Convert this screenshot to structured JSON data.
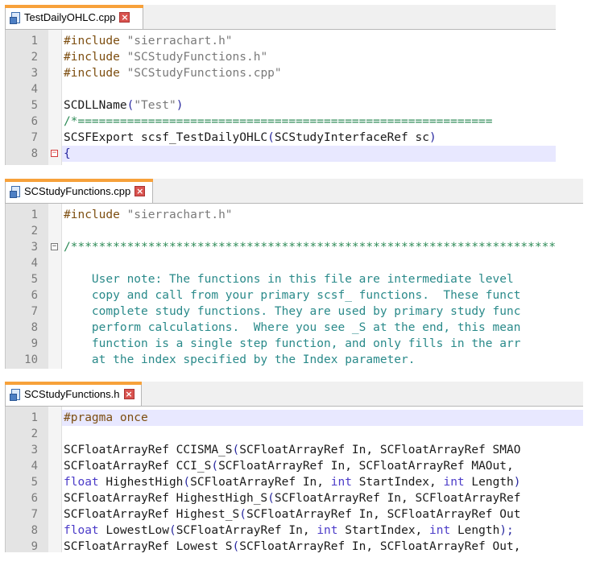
{
  "panels": [
    {
      "tab": "TestDailyOHLC.cpp",
      "lines": [
        {
          "n": "1",
          "segs": [
            [
              "pre",
              "#include "
            ],
            [
              "str",
              "\"sierrachart.h\""
            ]
          ]
        },
        {
          "n": "2",
          "segs": [
            [
              "pre",
              "#include "
            ],
            [
              "str",
              "\"SCStudyFunctions.h\""
            ]
          ]
        },
        {
          "n": "3",
          "segs": [
            [
              "pre",
              "#include "
            ],
            [
              "str",
              "\"SCStudyFunctions.cpp\""
            ]
          ]
        },
        {
          "n": "4",
          "segs": []
        },
        {
          "n": "5",
          "segs": [
            [
              "txt",
              "SCDLLName"
            ],
            [
              "punc",
              "("
            ],
            [
              "str",
              "\"Test\""
            ],
            [
              "punc",
              ")"
            ]
          ]
        },
        {
          "n": "6",
          "segs": [
            [
              "com",
              "/*==========================================================="
            ]
          ]
        },
        {
          "n": "7",
          "segs": [
            [
              "txt",
              "SCSFExport scsf_TestDailyOHLC"
            ],
            [
              "punc",
              "("
            ],
            [
              "txt",
              "SCStudyInterfaceRef sc"
            ],
            [
              "punc",
              ")"
            ]
          ]
        },
        {
          "n": "8",
          "segs": [
            [
              "punc",
              "{"
            ]
          ]
        }
      ]
    },
    {
      "tab": "SCStudyFunctions.cpp",
      "lines": [
        {
          "n": "1",
          "segs": [
            [
              "pre",
              "#include "
            ],
            [
              "str",
              "\"sierrachart.h\""
            ]
          ]
        },
        {
          "n": "2",
          "segs": []
        },
        {
          "n": "3",
          "segs": [
            [
              "com",
              "/*********************************************************************"
            ]
          ]
        },
        {
          "n": "4",
          "segs": []
        },
        {
          "n": "5",
          "segs": [
            [
              "note",
              "    User note: The functions in this file are intermediate level"
            ]
          ]
        },
        {
          "n": "6",
          "segs": [
            [
              "note",
              "    copy and call from your primary scsf_ functions.  These funct"
            ]
          ]
        },
        {
          "n": "7",
          "segs": [
            [
              "note",
              "    complete study functions. They are used by primary study func"
            ]
          ]
        },
        {
          "n": "8",
          "segs": [
            [
              "note",
              "    perform calculations.  Where you see _S at the end, this mean"
            ]
          ]
        },
        {
          "n": "9",
          "segs": [
            [
              "note",
              "    function is a single step function, and only fills in the arr"
            ]
          ]
        },
        {
          "n": "10",
          "segs": [
            [
              "note",
              "    at the index specified by the Index parameter."
            ]
          ]
        }
      ]
    },
    {
      "tab": "SCStudyFunctions.h",
      "lines": [
        {
          "n": "1",
          "segs": [
            [
              "pre",
              "#pragma once"
            ]
          ]
        },
        {
          "n": "2",
          "segs": []
        },
        {
          "n": "3",
          "segs": [
            [
              "txt",
              "SCFloatArrayRef CCISMA_S"
            ],
            [
              "punc",
              "("
            ],
            [
              "txt",
              "SCFloatArrayRef In, SCFloatArrayRef SMAO"
            ]
          ]
        },
        {
          "n": "4",
          "segs": [
            [
              "txt",
              "SCFloatArrayRef CCI_S"
            ],
            [
              "punc",
              "("
            ],
            [
              "txt",
              "SCFloatArrayRef In, SCFloatArrayRef MAOut,"
            ]
          ]
        },
        {
          "n": "5",
          "segs": [
            [
              "kw",
              "float"
            ],
            [
              "txt",
              " HighestHigh"
            ],
            [
              "punc",
              "("
            ],
            [
              "txt",
              "SCFloatArrayRef In, "
            ],
            [
              "kw",
              "int"
            ],
            [
              "txt",
              " StartIndex, "
            ],
            [
              "kw",
              "int"
            ],
            [
              "txt",
              " Length"
            ],
            [
              "punc",
              ")"
            ]
          ]
        },
        {
          "n": "6",
          "segs": [
            [
              "txt",
              "SCFloatArrayRef HighestHigh_S"
            ],
            [
              "punc",
              "("
            ],
            [
              "txt",
              "SCFloatArrayRef In, SCFloatArrayRef"
            ]
          ]
        },
        {
          "n": "7",
          "segs": [
            [
              "txt",
              "SCFloatArrayRef Highest_S"
            ],
            [
              "punc",
              "("
            ],
            [
              "txt",
              "SCFloatArrayRef In, SCFloatArrayRef Out"
            ]
          ]
        },
        {
          "n": "8",
          "segs": [
            [
              "kw",
              "float"
            ],
            [
              "txt",
              " LowestLow"
            ],
            [
              "punc",
              "("
            ],
            [
              "txt",
              "SCFloatArrayRef In, "
            ],
            [
              "kw",
              "int"
            ],
            [
              "txt",
              " StartIndex, "
            ],
            [
              "kw",
              "int"
            ],
            [
              "txt",
              " Length"
            ],
            [
              "punc",
              ");"
            ]
          ]
        },
        {
          "n": "9",
          "segs": [
            [
              "txt",
              "SCFloatArrayRef Lowest_S"
            ],
            [
              "punc",
              "("
            ],
            [
              "txt",
              "SCFloatArrayRef In, SCFloatArrayRef Out,"
            ]
          ]
        }
      ]
    }
  ]
}
